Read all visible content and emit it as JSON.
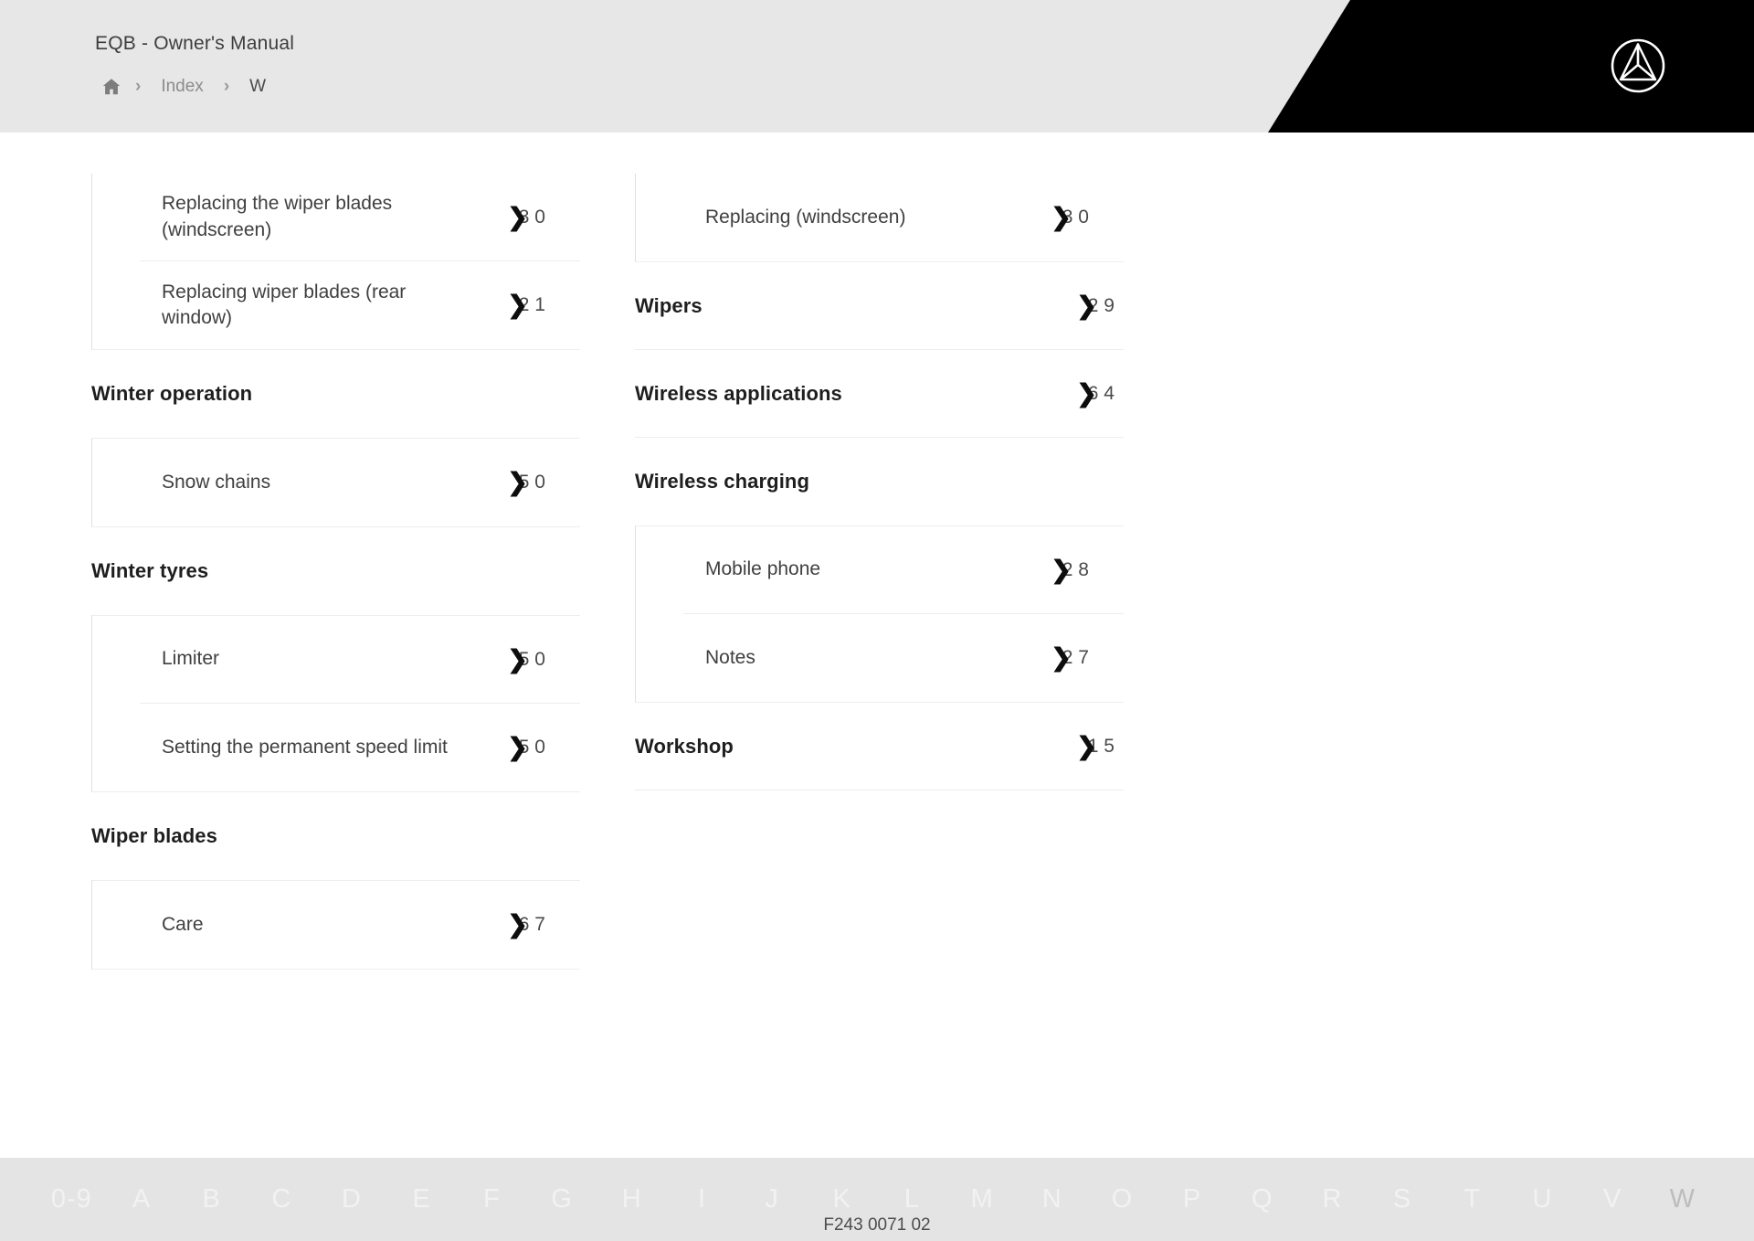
{
  "header": {
    "title": "EQB - Owner's Manual",
    "breadcrumb": {
      "home_icon": "home-icon",
      "separator": "›",
      "items": [
        "Index",
        "W"
      ]
    },
    "logo": "mercedes-benz-star-logo"
  },
  "columns": [
    {
      "blocks": [
        {
          "type": "subgroup",
          "entries": [
            {
              "label": "Replacing the wiper blades (windscreen)",
              "page": "3'0"
            },
            {
              "label": "Replacing wiper blades (rear window)",
              "page": "2'1"
            }
          ]
        },
        {
          "type": "heading",
          "label": "Winter operation",
          "page": ""
        },
        {
          "type": "subgroup",
          "entries": [
            {
              "label": "Snow chains",
              "page": "5'0"
            }
          ]
        },
        {
          "type": "heading",
          "label": "Winter tyres",
          "page": ""
        },
        {
          "type": "subgroup",
          "entries": [
            {
              "label": "Limiter",
              "page": "5'0"
            },
            {
              "label": "Setting the permanent speed limit",
              "page": "5'0"
            }
          ]
        },
        {
          "type": "heading",
          "label": "Wiper blades",
          "page": ""
        },
        {
          "type": "subgroup",
          "entries": [
            {
              "label": "Care",
              "page": "6'7"
            }
          ]
        }
      ]
    },
    {
      "blocks": [
        {
          "type": "subgroup",
          "entries": [
            {
              "label": "Replacing (windscreen)",
              "page": "3'0"
            }
          ]
        },
        {
          "type": "heading",
          "label": "Wipers",
          "page": "2'9"
        },
        {
          "type": "heading",
          "label": "Wireless applications",
          "page": "6'4"
        },
        {
          "type": "heading",
          "label": "Wireless charging",
          "page": ""
        },
        {
          "type": "subgroup",
          "entries": [
            {
              "label": "Mobile phone",
              "page": "2'8"
            },
            {
              "label": "Notes",
              "page": "2'7"
            }
          ]
        },
        {
          "type": "heading",
          "label": "Workshop",
          "page": "1'5"
        }
      ]
    }
  ],
  "chevron_glyph": "❯",
  "alphabar": {
    "letters": [
      "0-9",
      "A",
      "B",
      "C",
      "D",
      "E",
      "F",
      "G",
      "H",
      "I",
      "J",
      "K",
      "L",
      "M",
      "N",
      "O",
      "P",
      "Q",
      "R",
      "S",
      "T",
      "U",
      "V",
      "W"
    ],
    "active": "W"
  },
  "footer": {
    "document_number": "F243 0071 02"
  }
}
